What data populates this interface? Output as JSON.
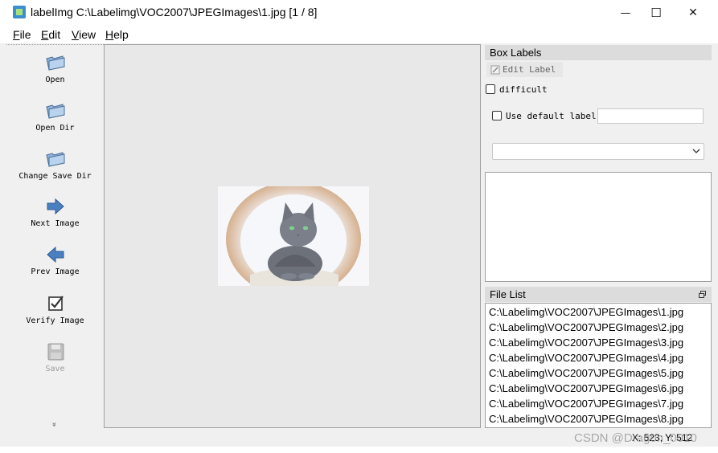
{
  "window": {
    "title": "labelImg C:\\Labelimg\\VOC2007\\JPEGImages\\1.jpg [1 / 8]",
    "minimize_glyph": "—",
    "maximize_glyph": "☐",
    "close_glyph": "✕"
  },
  "menu": [
    {
      "key": "F",
      "rest": "ile"
    },
    {
      "key": "E",
      "rest": "dit"
    },
    {
      "key": "V",
      "rest": "iew"
    },
    {
      "key": "H",
      "rest": "elp"
    }
  ],
  "toolbar": {
    "open": "Open",
    "open_dir": "Open Dir",
    "change_save_dir": "Change Save Dir",
    "next_image": "Next Image",
    "prev_image": "Prev Image",
    "verify_image": "Verify Image",
    "save": "Save",
    "more_glyph": "»"
  },
  "box_labels": {
    "title": "Box Labels",
    "edit_label": "Edit Label",
    "difficult": "difficult",
    "use_default_label": "Use default label",
    "default_label_value": "",
    "combo_value": ""
  },
  "file_list": {
    "title": "File List",
    "items": [
      "C:\\Labelimg\\VOC2007\\JPEGImages\\1.jpg",
      "C:\\Labelimg\\VOC2007\\JPEGImages\\2.jpg",
      "C:\\Labelimg\\VOC2007\\JPEGImages\\3.jpg",
      "C:\\Labelimg\\VOC2007\\JPEGImages\\4.jpg",
      "C:\\Labelimg\\VOC2007\\JPEGImages\\5.jpg",
      "C:\\Labelimg\\VOC2007\\JPEGImages\\6.jpg",
      "C:\\Labelimg\\VOC2007\\JPEGImages\\7.jpg",
      "C:\\Labelimg\\VOC2007\\JPEGImages\\8.jpg"
    ]
  },
  "status": {
    "coords": "X: 523; Y: 512",
    "watermark": "CSDN @Dragon_0010"
  },
  "colors": {
    "icon_blue": "#4a7fc1",
    "disabled_gray": "#9a9a9a",
    "canvas_bg": "#e8e8e8"
  }
}
